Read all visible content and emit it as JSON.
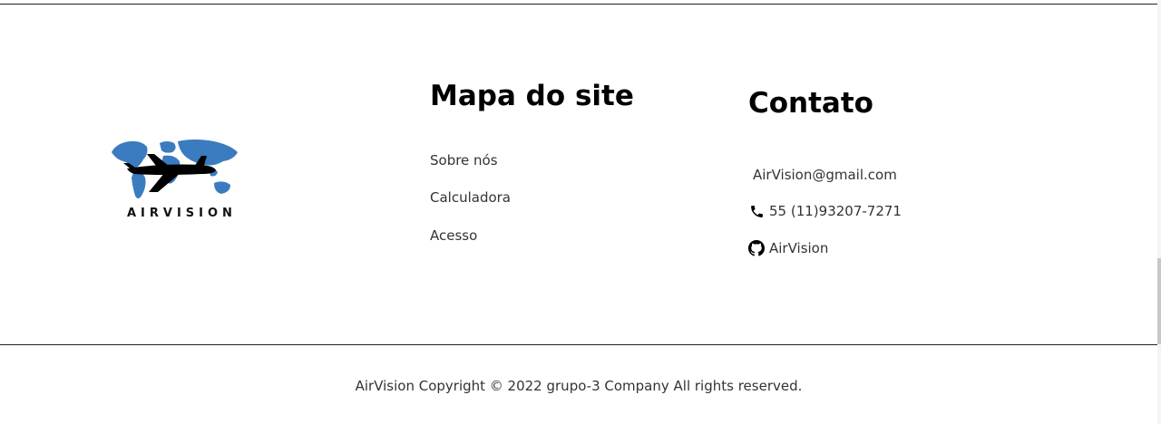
{
  "logo": {
    "text": "AIRVISION",
    "map_color": "#3b7bbf",
    "plane_color": "#000000"
  },
  "sitemap": {
    "title": "Mapa do site",
    "links": [
      "Sobre nós",
      "Calculadora",
      "Acesso"
    ]
  },
  "contact": {
    "title": "Contato",
    "email": "AirVision@gmail.com",
    "phone": "55 (11)93207-7271",
    "github": "AirVision",
    "phone_icon": "phone-icon",
    "github_icon": "github-icon"
  },
  "footer": {
    "copyright": "AirVision Copyright © 2022 grupo-3 Company All rights reserved."
  }
}
